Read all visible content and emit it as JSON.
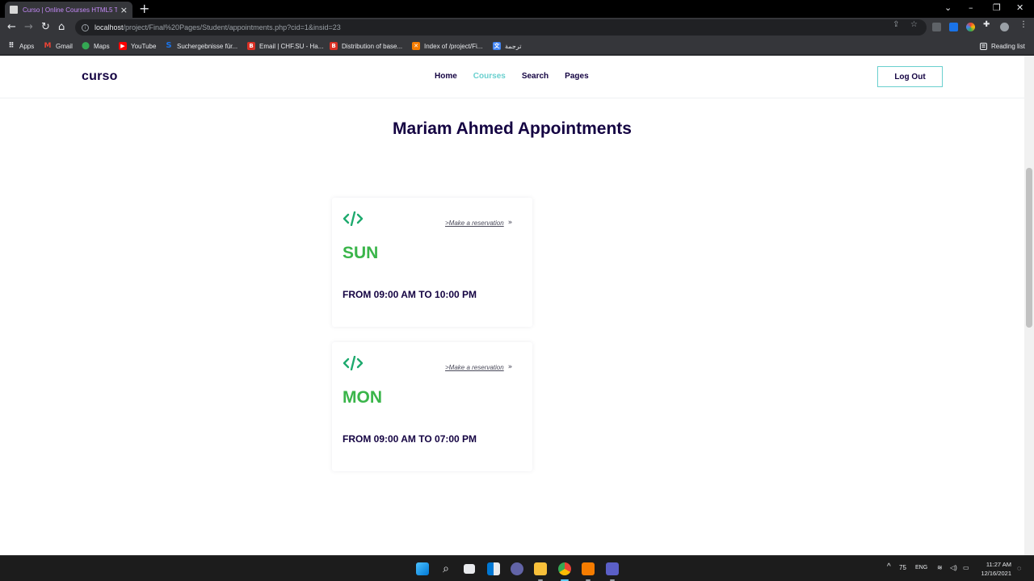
{
  "browser": {
    "tab_title": "Curso | Online Courses HTML5 Te",
    "url_host": "localhost",
    "url_path": "/project/Final%20Pages/Student/appointments.php?cid=1&insid=23",
    "bookmarks": [
      {
        "label": "Apps",
        "icon": "apps-grid-icon",
        "color": "#e8eaed"
      },
      {
        "label": "Gmail",
        "icon": "gmail-icon",
        "color": "#ea4335"
      },
      {
        "label": "Maps",
        "icon": "maps-icon",
        "color": "#34a853"
      },
      {
        "label": "YouTube",
        "icon": "youtube-icon",
        "color": "#ff0000"
      },
      {
        "label": "Suchergebnisse für...",
        "icon": "search-s-icon",
        "color": "#1a73e8"
      },
      {
        "label": "Email | CHF.SU - Ha...",
        "icon": "b-icon",
        "color": "#d93025"
      },
      {
        "label": "Distribution of base...",
        "icon": "b-icon",
        "color": "#d93025"
      },
      {
        "label": "Index of /project/Fi...",
        "icon": "xampp-icon",
        "color": "#f57c00"
      },
      {
        "label": "ترجمة",
        "icon": "translate-icon",
        "color": "#4285f4"
      }
    ],
    "reading_list": "Reading list"
  },
  "site": {
    "brand": "curso",
    "nav": [
      "Home",
      "Courses",
      "Search",
      "Pages"
    ],
    "active_nav": "Courses",
    "logout": "Log Out",
    "accent": "#6ad0cf",
    "primary": "#140342",
    "day_color": "#3ab54a"
  },
  "main": {
    "title": "Mariam Ahmed Appointments",
    "appointments": [
      {
        "day": "SUN",
        "hours": "FROM 09:00 AM TO 10:00 PM",
        "reserve": ">Make a reservation"
      },
      {
        "day": "MON",
        "hours": "FROM 09:00 AM TO 07:00 PM",
        "reserve": ">Make a reservation"
      }
    ]
  },
  "taskbar": {
    "temperature": "75",
    "language": "ENG",
    "time": "11:27 AM",
    "date": "12/16/2021"
  }
}
